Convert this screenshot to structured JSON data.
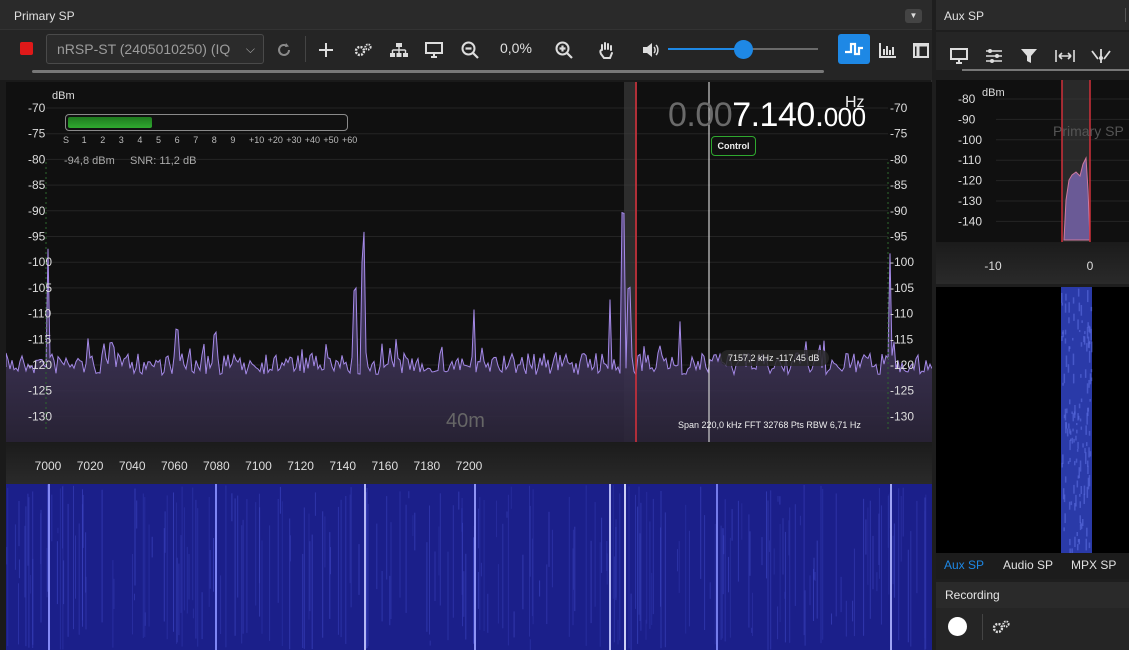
{
  "primary": {
    "title": "Primary SP",
    "device": "nRSP-ST (2405010250) (IQ",
    "zoom": "0,0%",
    "volume_fraction": 0.5,
    "freq_prefix": "0.00",
    "freq_main": "7.140.",
    "freq_sub": "000",
    "freq_unit": "Hz",
    "control_label": "Control",
    "dbm_label": "dBm",
    "smeter_scale": [
      "S",
      "1",
      "2",
      "3",
      "4",
      "5",
      "6",
      "7",
      "8",
      "9",
      "+10",
      "+20",
      "+30",
      "+40",
      "+50",
      "+60"
    ],
    "smeter_fraction": 0.3,
    "level": "-94,8 dBm",
    "snr": "SNR:  11,2 dB",
    "y_ticks": [
      "-70",
      "-75",
      "-80",
      "-85",
      "-90",
      "-95",
      "-100",
      "-105",
      "-110",
      "-115",
      "-120",
      "-125",
      "-130"
    ],
    "band_label": "40m",
    "cursor_readout": "7157,2 kHz  -117,45 dB",
    "span_info": "Span 220,0 kHz FFT 32768 Pts  RBW 6,71 Hz",
    "x_ticks": [
      "7000",
      "7020",
      "7040",
      "7060",
      "7080",
      "7100",
      "7120",
      "7140",
      "7160",
      "7180",
      "7200"
    ]
  },
  "aux": {
    "title": "Aux SP",
    "dbm_label": "dBm",
    "y_ticks": [
      "-80",
      "-90",
      "-100",
      "-110",
      "-120",
      "-130",
      "-140"
    ],
    "watermark": "Primary SP",
    "x_ticks": [
      "-10",
      "0"
    ],
    "tabs": [
      "Aux SP",
      "Audio SP",
      "MPX SP"
    ],
    "recording_title": "Recording"
  },
  "colors": {
    "accent": "#1e88e5",
    "trace": "#a58ae8",
    "filter": "#d0303a",
    "waterfall": "#1b1f8a",
    "stop": "#e01919"
  },
  "icons": [
    "stop-icon",
    "refresh-icon",
    "plus-icon",
    "gears-icon",
    "network-icon",
    "monitor-icon",
    "zoom-out-icon",
    "zoom-in-icon",
    "hand-icon",
    "volume-icon",
    "spectrum-icon",
    "bars-icon",
    "layout-icon",
    "sliders-icon",
    "filter-icon",
    "width-icon",
    "antenna-icon"
  ]
}
